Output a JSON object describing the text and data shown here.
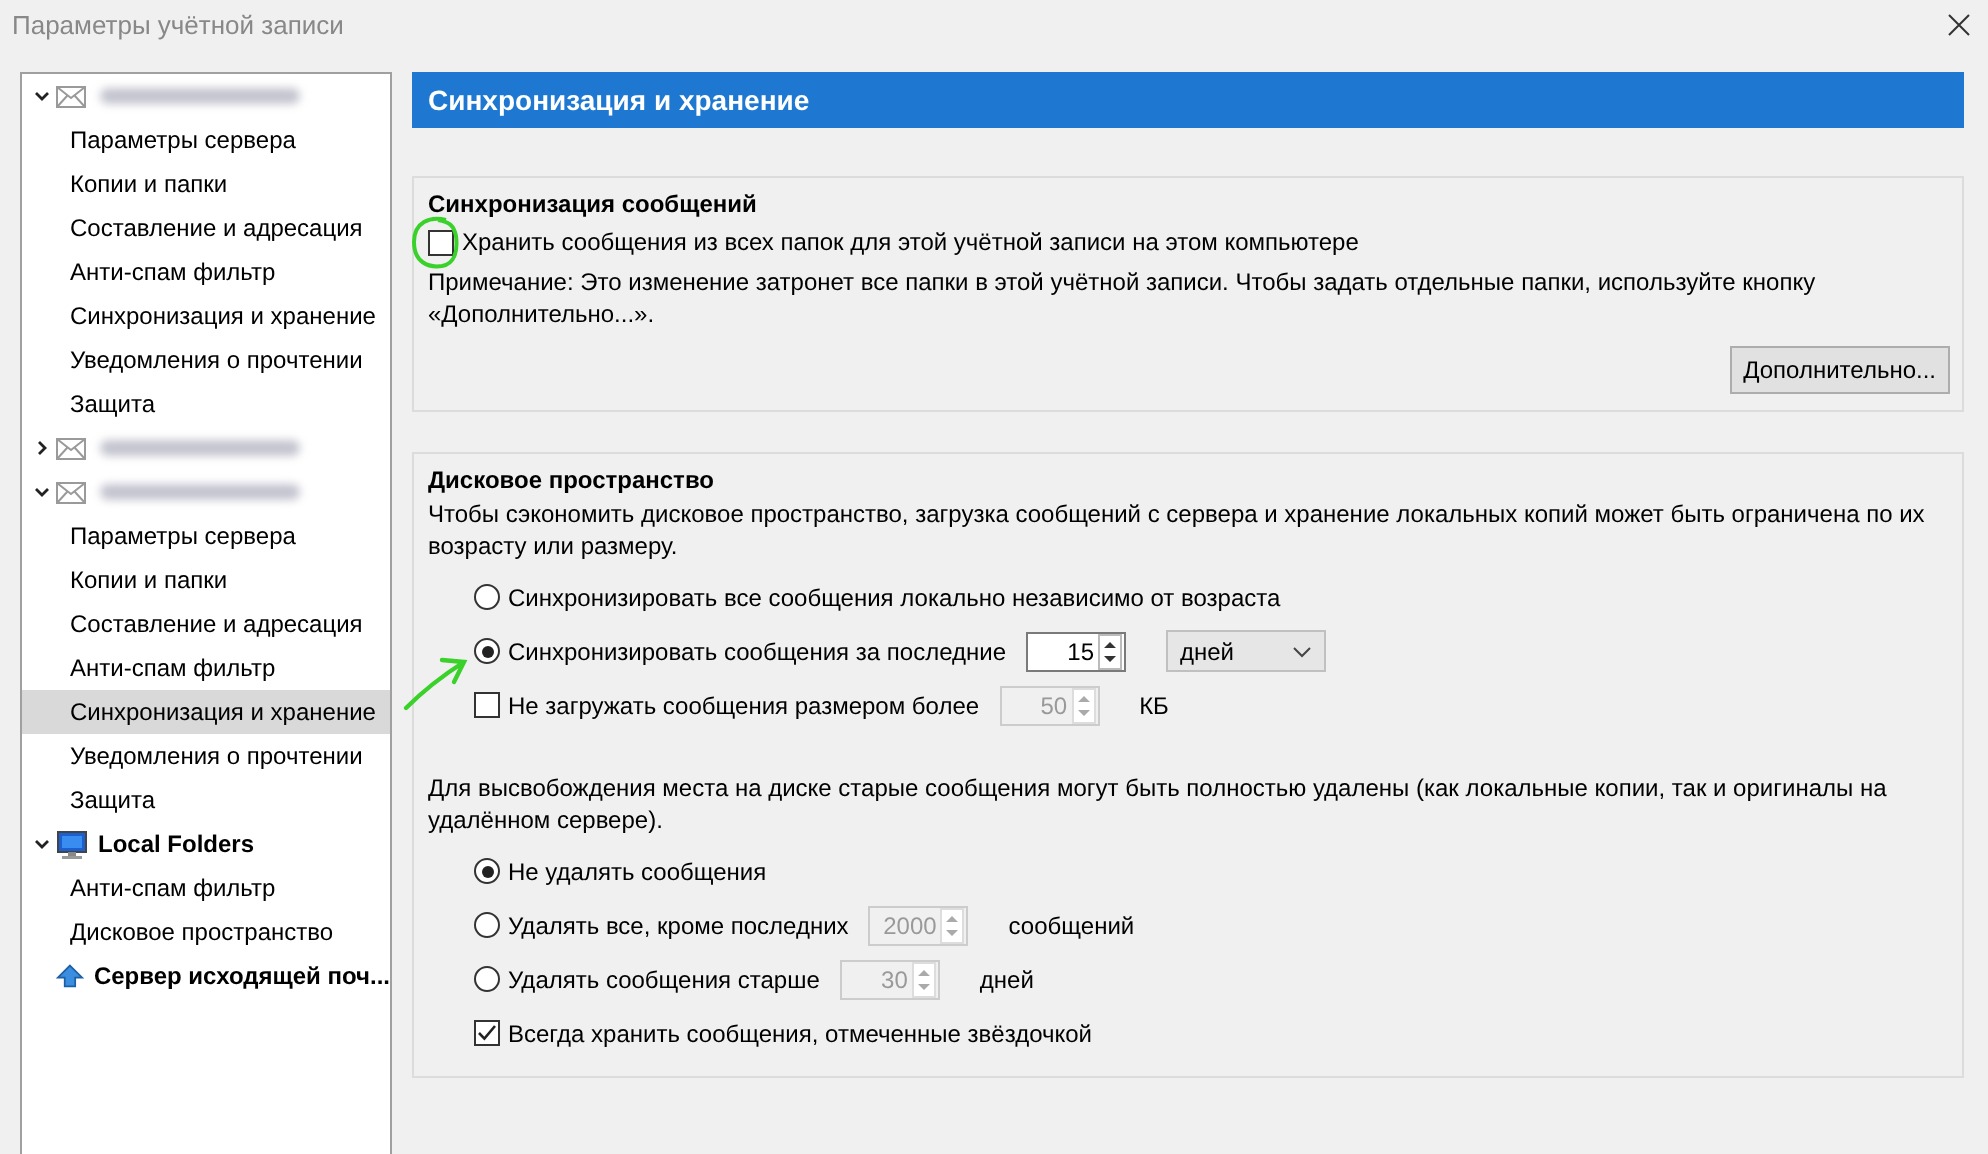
{
  "window": {
    "title": "Параметры учётной записи"
  },
  "tree": [
    {
      "kind": "account",
      "expanded": true,
      "selected": false,
      "children": [
        {
          "label": "Параметры сервера",
          "selected": false
        },
        {
          "label": "Копии и папки",
          "selected": false
        },
        {
          "label": "Составление и адресация",
          "selected": false
        },
        {
          "label": "Анти-спам фильтр",
          "selected": false
        },
        {
          "label": "Синхронизация и хранение",
          "selected": false
        },
        {
          "label": "Уведомления о прочтении",
          "selected": false
        },
        {
          "label": "Защита",
          "selected": false
        }
      ]
    },
    {
      "kind": "account",
      "expanded": false,
      "selected": false
    },
    {
      "kind": "account",
      "expanded": true,
      "selected": false,
      "children": [
        {
          "label": "Параметры сервера",
          "selected": false
        },
        {
          "label": "Копии и папки",
          "selected": false
        },
        {
          "label": "Составление и адресация",
          "selected": false
        },
        {
          "label": "Анти-спам фильтр",
          "selected": false
        },
        {
          "label": "Синхронизация и хранение",
          "selected": true
        },
        {
          "label": "Уведомления о прочтении",
          "selected": false
        },
        {
          "label": "Защита",
          "selected": false
        }
      ]
    },
    {
      "kind": "local",
      "label": "Local Folders",
      "expanded": true,
      "selected": false,
      "children": [
        {
          "label": "Анти-спам фильтр",
          "selected": false
        },
        {
          "label": "Дисковое пространство",
          "selected": false
        }
      ]
    },
    {
      "kind": "server",
      "label": "Сервер исходящей поч...",
      "selected": false
    }
  ],
  "panel": {
    "title": "Синхронизация и хранение"
  },
  "sync_group": {
    "title": "Синхронизация сообщений",
    "keep_all": {
      "label": "Хранить сообщения из всех папок для этой учётной записи на этом компьютере",
      "checked": false
    },
    "note": "Примечание: Это изменение затронет все папки в этой учётной записи. Чтобы задать отдельные папки, используйте кнопку «Дополнительно...».",
    "button": "Дополнительно..."
  },
  "disk_group": {
    "title": "Дисковое пространство",
    "description": "Чтобы сэкономить дисковое пространство, загрузка сообщений с сервера и хранение локальных копий может быть ограничена по их возрасту или размеру.",
    "sync_options": [
      {
        "kind": "radio",
        "label": "Синхронизировать все сообщения локально независимо от возраста",
        "selected": false
      },
      {
        "kind": "radio",
        "label": "Синхронизировать сообщения за последние",
        "selected": true,
        "spinner": {
          "value": "15",
          "disabled": false
        },
        "dropdown": "дней"
      },
      {
        "kind": "check",
        "label": "Не загружать сообщения размером более",
        "checked": false,
        "spinner": {
          "value": "50",
          "disabled": true
        },
        "unit": "КБ"
      }
    ],
    "cleanup_description": "Для высвобождения места на диске старые сообщения могут быть полностью удалены (как локальные копии, так и оригиналы на удалённом сервере).",
    "cleanup_options": [
      {
        "kind": "radio",
        "label": "Не удалять сообщения",
        "selected": true
      },
      {
        "kind": "radio",
        "label": "Удалять все, кроме последних",
        "selected": false,
        "spinner": {
          "value": "2000",
          "disabled": true
        },
        "unit": "сообщений"
      },
      {
        "kind": "radio",
        "label": "Удалять сообщения старше",
        "selected": false,
        "spinner": {
          "value": "30",
          "disabled": true
        },
        "unit": "дней"
      },
      {
        "kind": "check",
        "label": "Всегда хранить сообщения, отмеченные звёздочкой",
        "checked": true
      }
    ]
  }
}
